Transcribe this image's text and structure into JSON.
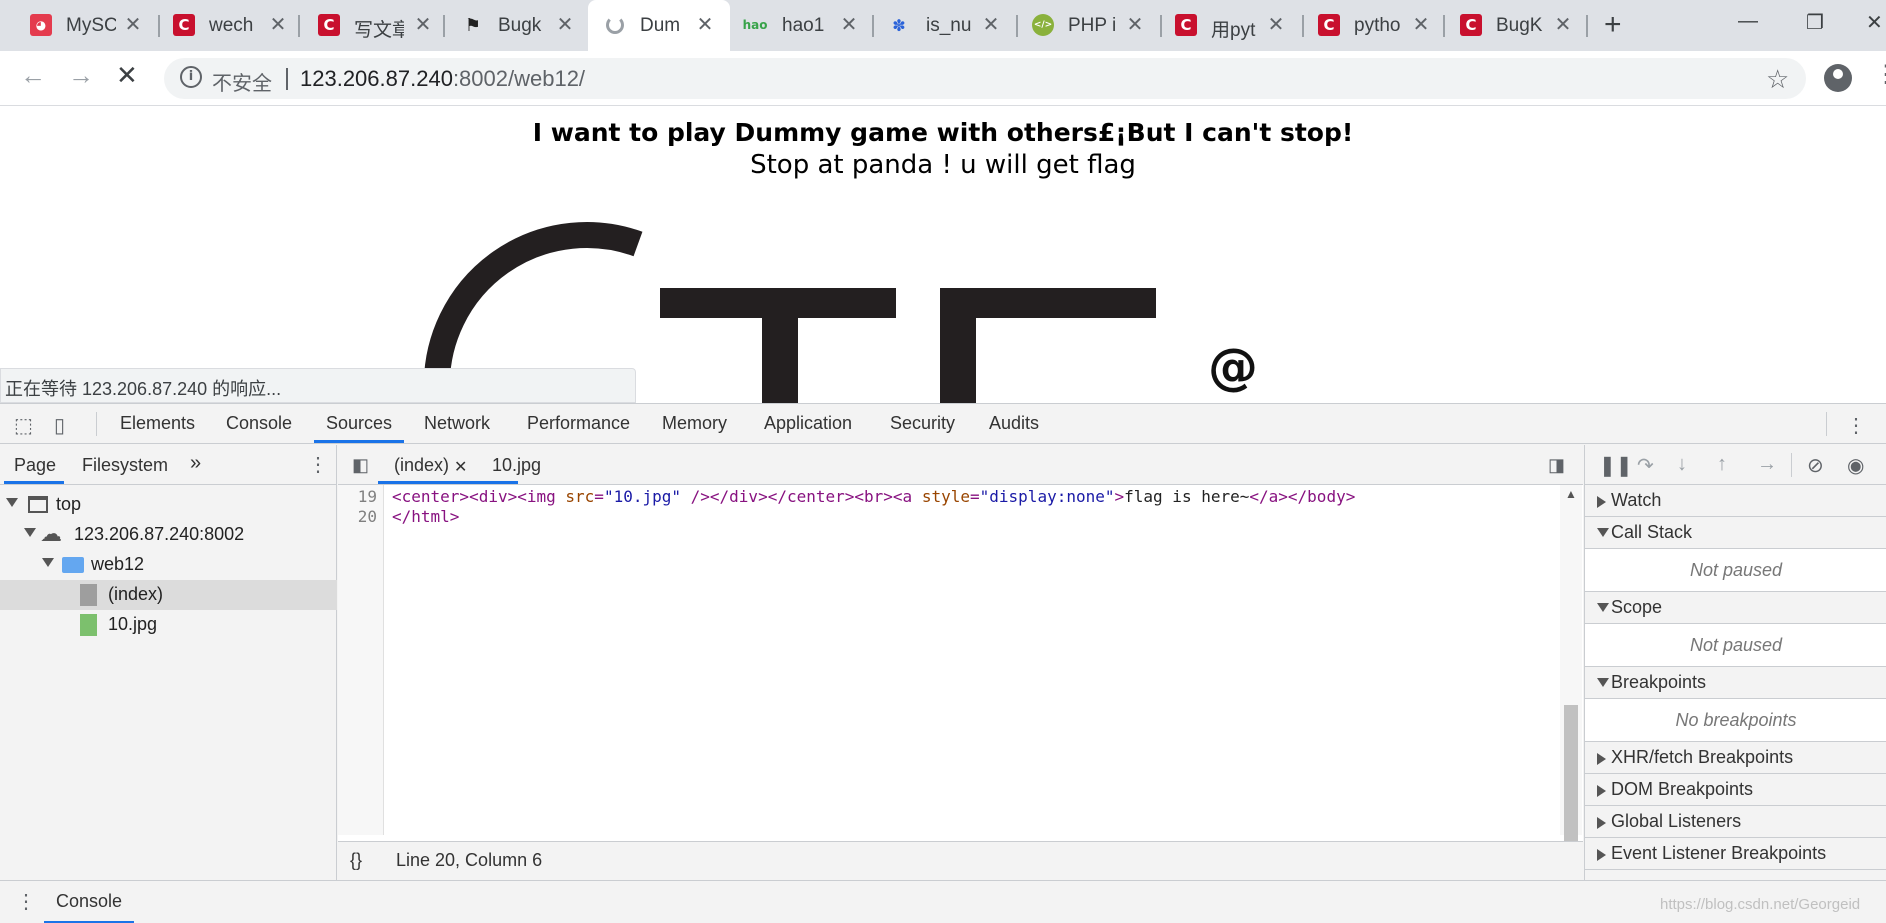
{
  "browser": {
    "tabs": [
      {
        "title": "MySC",
        "icon": "bunny-icon"
      },
      {
        "title": "wech",
        "icon": "csdn-icon"
      },
      {
        "title": "写文章",
        "icon": "csdn-icon"
      },
      {
        "title": "Bugk",
        "icon": "flag-icon"
      },
      {
        "title": "Dum",
        "icon": "loading-icon"
      },
      {
        "title": "hao1",
        "icon": "hao-icon"
      },
      {
        "title": "is_nu",
        "icon": "baidu-icon"
      },
      {
        "title": "PHP i",
        "icon": "php-icon"
      },
      {
        "title": "用pyt",
        "icon": "csdn-icon"
      },
      {
        "title": "pytho",
        "icon": "csdn-icon"
      },
      {
        "title": "BugK",
        "icon": "csdn-icon"
      }
    ],
    "omnibox": {
      "security_label": "不安全",
      "host": "123.206.87.240",
      "rest": ":8002/web12/"
    }
  },
  "page": {
    "headline": "I want to play Dummy game with others£¡But I can't stop!",
    "subline": "Stop at panda ! u will get flag",
    "at_symbol": "@",
    "status": "正在等待 123.206.87.240 的响应..."
  },
  "devtools": {
    "tabs": [
      "Elements",
      "Console",
      "Sources",
      "Network",
      "Performance",
      "Memory",
      "Application",
      "Security",
      "Audits"
    ],
    "active_tab": "Sources",
    "navigator": {
      "tabs": [
        "Page",
        "Filesystem"
      ],
      "tree": [
        {
          "label": "top",
          "depth": 0
        },
        {
          "label": "123.206.87.240:8002",
          "depth": 1
        },
        {
          "label": "web12",
          "depth": 2
        },
        {
          "label": "(index)",
          "depth": 3,
          "selected": true
        },
        {
          "label": "10.jpg",
          "depth": 3
        }
      ]
    },
    "editor": {
      "tabs": [
        "(index)",
        "10.jpg"
      ],
      "lines": [
        {
          "no": "19"
        },
        {
          "no": "20"
        }
      ],
      "code": {
        "l19_a": "<center><div><img ",
        "l19_attr1": "src",
        "l19_eq1": "=",
        "l19_val1": "\"10.jpg\"",
        "l19_b": " /></div></center><br><a ",
        "l19_attr2": "style",
        "l19_eq2": "=",
        "l19_val2": "\"display:none\"",
        "l19_c": ">",
        "l19_text": "flag is here~",
        "l19_d": "</a></body>",
        "l20": "</html>"
      },
      "status": "Line 20, Column 6",
      "format_label": "{}"
    },
    "debugger": {
      "sections": {
        "watch": "Watch",
        "call_stack": "Call Stack",
        "call_stack_body": "Not paused",
        "scope": "Scope",
        "scope_body": "Not paused",
        "breakpoints": "Breakpoints",
        "breakpoints_body": "No breakpoints",
        "xhr": "XHR/fetch Breakpoints",
        "dom": "DOM Breakpoints",
        "global": "Global Listeners",
        "event": "Event Listener Breakpoints"
      }
    },
    "drawer_tab": "Console",
    "watermark": "https://blog.csdn.net/Georgeid"
  },
  "colors": {
    "accent": "#1a73e8",
    "tag": "#881280",
    "attr": "#994500",
    "value": "#1a1aa6"
  }
}
